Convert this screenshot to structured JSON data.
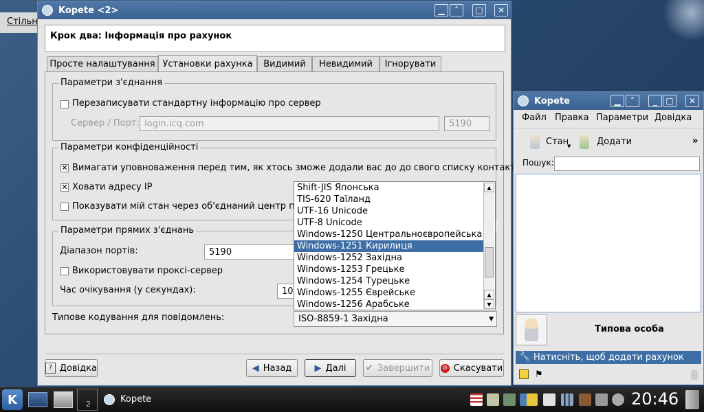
{
  "desktop": {
    "left_label": "Стільн"
  },
  "main_window": {
    "title": "Kopete <2>",
    "header": "Крок два: Інформація про рахунок",
    "tabs": [
      "Просте налаштування",
      "Установки рахунка",
      "Видимий",
      "Невидимий",
      "Ігнорувати"
    ],
    "connection": {
      "title": "Параметри з'єднання",
      "override_label": "Перезаписувати стандартну інформацію про сервер",
      "server_label": "Сервер / Порт:",
      "server_value": "login.icq.com",
      "port_value": "5190"
    },
    "privacy": {
      "title": "Параметри конфіденційності",
      "auth_label": "Вимагати уповноваження перед тим, як хтось зможе додали вас до до свого списку контактів",
      "hide_ip_label": "Ховати адресу IP",
      "show_status_label": "Показувати мій стан через об'єднаний центр повід"
    },
    "direct": {
      "title": "Параметри прямих з'єднань",
      "port_range_label": "Діапазон портів:",
      "port_range_value": "5190",
      "proxy_label": "Використовувати проксі-сервер",
      "timeout_label": "Час очікування (у секундах):",
      "timeout_value": "10"
    },
    "encoding": {
      "label": "Типове кодування для повідомлень:",
      "value": "ISO-8859-1 Західна",
      "options": [
        "Shift-JIS Японська",
        "TIS-620 Таїланд",
        "UTF-16 Unicode",
        "UTF-8 Unicode",
        "Windows-1250 Центральноєвропейська",
        "Windows-1251 Кирилиця",
        "Windows-1252 Західна",
        "Windows-1253 Грецьке",
        "Windows-1254 Турецьке",
        "Windows-1255 Єврейське",
        "Windows-1256 Арабське"
      ],
      "selected_index": 5
    },
    "buttons": {
      "help": "Довідка",
      "back": "Назад",
      "next": "Далі",
      "finish": "Завершити",
      "cancel": "Скасувати"
    }
  },
  "kopete_window": {
    "title": "Kopete",
    "menu": [
      "Файл",
      "Правка",
      "Параметри",
      "Довідка"
    ],
    "toolbar": {
      "status": "Стан",
      "add": "Додати",
      "more": "»"
    },
    "search_label": "Пошук:",
    "search_value": "",
    "identity": "Типова особа",
    "add_account": "Натисніть, щоб додати рахунок"
  },
  "taskbar": {
    "task_label": "Kopete",
    "desktop_number": "2",
    "clock": "20:46"
  },
  "colors": {
    "titlebar": "#3b6291",
    "selection": "#3e6ea6",
    "taskbar": "#1a1a1a"
  }
}
